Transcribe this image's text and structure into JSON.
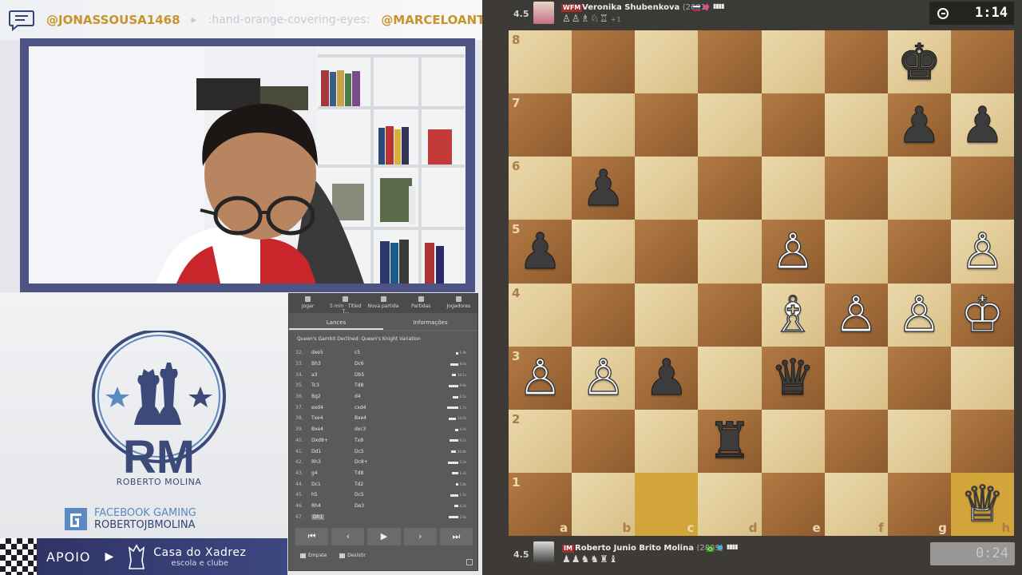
{
  "ticker": {
    "user1": "@JONASSOUSA1468",
    "msg1": ":hand-orange-covering-eyes:",
    "user2": "@MARCELOANTUN"
  },
  "branding": {
    "logo_initials": "RM",
    "name": "ROBERTO MOLINA",
    "fb_line1": "FACEBOOK GAMING",
    "fb_line2": "ROBERTOJBMOLINA",
    "support_label": "APOIO",
    "sponsor_line1": "Casa do Xadrez",
    "sponsor_line2": "escola e clube"
  },
  "game_panel": {
    "tabs": [
      "Jogar",
      "5 min · Titled T...",
      "Nova partida",
      "Partidas",
      "Jogadores"
    ],
    "subtabs": [
      "Lances",
      "Informações"
    ],
    "opening": "Queen's Gambit Declined: Queen's Knight Variation",
    "moves": [
      {
        "num": "32.",
        "white": "dxe5",
        "black": "c5",
        "time": "1.9s"
      },
      {
        "num": "33.",
        "white": "Bh3",
        "black": "Dc6",
        "time": "8.0s"
      },
      {
        "num": "34.",
        "white": "a3",
        "black": "Db5",
        "time": "10.1s"
      },
      {
        "num": "35.",
        "white": "Tc3",
        "black": "Td8",
        "time": "9.6s"
      },
      {
        "num": "36.",
        "white": "Bg2",
        "black": "d4",
        "time": "0.5s"
      },
      {
        "num": "37.",
        "white": "exd4",
        "black": "cxd4",
        "time": "1.7s"
      },
      {
        "num": "38.",
        "white": "Txe4",
        "black": "Bxe4",
        "time": "14.0s"
      },
      {
        "num": "39.",
        "white": "Bxe4",
        "black": "dxc3",
        "time": "4.4s"
      },
      {
        "num": "40.",
        "white": "Dxd8+",
        "black": "Tx8",
        "time": "9.1s"
      },
      {
        "num": "41.",
        "white": "Dd1",
        "black": "Dc5",
        "time": "20.8s"
      },
      {
        "num": "42.",
        "white": "Rh3",
        "black": "Dc8+",
        "time": "3.3s"
      },
      {
        "num": "43.",
        "white": "g4",
        "black": "Td8",
        "time": "1.2s"
      },
      {
        "num": "44.",
        "white": "Dc1",
        "black": "Td2",
        "time": "5.8s"
      },
      {
        "num": "45.",
        "white": "h5",
        "black": "Dc5",
        "time": "1.5s"
      },
      {
        "num": "46.",
        "white": "Rh4",
        "black": "De3",
        "time": "4.3s"
      },
      {
        "num": "47.",
        "white": "Dh1",
        "black": "",
        "time": "2.6s"
      }
    ],
    "nav": [
      "⏮",
      "‹",
      "▶",
      "›",
      "⏭"
    ],
    "draw_label": "Empate",
    "resign_label": "Desistir"
  },
  "top_player": {
    "score": "4.5",
    "title": "WFM",
    "name": "Veronika Shubenkova",
    "rating": "(2681)",
    "captured": "♙♙♗♘♖",
    "captured_extra": "+1",
    "clock": "1:14"
  },
  "bottom_player": {
    "score": "4.5",
    "title": "IM",
    "name": "Roberto Junio Brito Molina",
    "rating": "(2889)",
    "captured": "♟♟♞♞♜♝",
    "clock": "0:24"
  },
  "board": {
    "files": [
      "a",
      "b",
      "c",
      "d",
      "e",
      "f",
      "g",
      "h"
    ],
    "ranks": [
      "8",
      "7",
      "6",
      "5",
      "4",
      "3",
      "2",
      "1"
    ],
    "highlight": [
      "c1",
      "h1"
    ],
    "pieces": {
      "g8": "bK",
      "g7": "bP",
      "h7": "bP",
      "b6": "bP",
      "a5": "bP",
      "e5": "wP",
      "h5": "wP",
      "e4": "wB",
      "f4": "wP",
      "g4": "wP",
      "h4": "wK",
      "a3": "wP",
      "b3": "wP",
      "c3": "bP",
      "e3": "bQ",
      "d2": "bR",
      "h1": "wQ"
    }
  },
  "colors": {
    "accent": "#3c4a7a",
    "light_square": "#e4cf9c",
    "dark_square": "#a06a3a",
    "highlight": "#d2a53a"
  }
}
